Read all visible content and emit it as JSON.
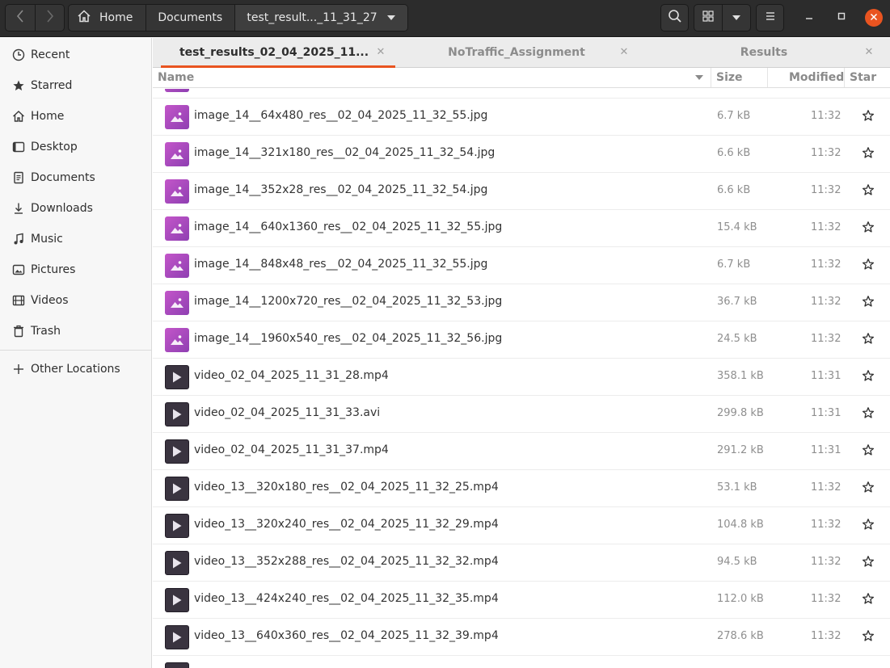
{
  "header": {
    "back_icon": "chevron-left-icon",
    "forward_icon": "chevron-right-icon",
    "breadcrumbs": [
      "Home",
      "Documents",
      "test_result..._11_31_27"
    ],
    "search_icon": "search-icon",
    "view_icon": "grid-view-icon",
    "view_menu_icon": "chevron-down-icon",
    "menu_icon": "hamburger-menu-icon"
  },
  "window": {
    "minimize_icon": "minimize-icon",
    "maximize_icon": "maximize-icon",
    "close_icon": "close-icon",
    "close_color": "#e95420"
  },
  "sidebar": {
    "items": [
      {
        "label": "Recent",
        "icon": "clock-icon"
      },
      {
        "label": "Starred",
        "icon": "star-icon"
      },
      {
        "label": "Home",
        "icon": "home-icon"
      },
      {
        "label": "Desktop",
        "icon": "desktop-icon"
      },
      {
        "label": "Documents",
        "icon": "document-icon"
      },
      {
        "label": "Downloads",
        "icon": "download-icon"
      },
      {
        "label": "Music",
        "icon": "music-icon"
      },
      {
        "label": "Pictures",
        "icon": "picture-icon"
      },
      {
        "label": "Videos",
        "icon": "video-icon"
      },
      {
        "label": "Trash",
        "icon": "trash-icon"
      }
    ],
    "other_locations": "Other Locations"
  },
  "tabs": [
    {
      "label": "test_results_02_04_2025_11...",
      "active": true
    },
    {
      "label": "NoTraffic_Assignment",
      "active": false
    },
    {
      "label": "Results",
      "active": false
    }
  ],
  "columns": {
    "name": "Name",
    "size": "Size",
    "modified": "Modified",
    "star": "Star"
  },
  "accent_color": "#e95420",
  "files": [
    {
      "name": "image_14__64x480_res__02_04_2025_11_32_55.jpg",
      "size": "6.7 kB",
      "modified": "11:32",
      "type": "image"
    },
    {
      "name": "image_14__321x180_res__02_04_2025_11_32_54.jpg",
      "size": "6.6 kB",
      "modified": "11:32",
      "type": "image"
    },
    {
      "name": "image_14__352x28_res__02_04_2025_11_32_54.jpg",
      "size": "6.6 kB",
      "modified": "11:32",
      "type": "image"
    },
    {
      "name": "image_14__640x1360_res__02_04_2025_11_32_55.jpg",
      "size": "15.4 kB",
      "modified": "11:32",
      "type": "image"
    },
    {
      "name": "image_14__848x48_res__02_04_2025_11_32_55.jpg",
      "size": "6.7 kB",
      "modified": "11:32",
      "type": "image"
    },
    {
      "name": "image_14__1200x720_res__02_04_2025_11_32_53.jpg",
      "size": "36.7 kB",
      "modified": "11:32",
      "type": "image"
    },
    {
      "name": "image_14__1960x540_res__02_04_2025_11_32_56.jpg",
      "size": "24.5 kB",
      "modified": "11:32",
      "type": "image"
    },
    {
      "name": "video_02_04_2025_11_31_28.mp4",
      "size": "358.1 kB",
      "modified": "11:31",
      "type": "video"
    },
    {
      "name": "video_02_04_2025_11_31_33.avi",
      "size": "299.8 kB",
      "modified": "11:31",
      "type": "video"
    },
    {
      "name": "video_02_04_2025_11_31_37.mp4",
      "size": "291.2 kB",
      "modified": "11:31",
      "type": "video"
    },
    {
      "name": "video_13__320x180_res__02_04_2025_11_32_25.mp4",
      "size": "53.1 kB",
      "modified": "11:32",
      "type": "video"
    },
    {
      "name": "video_13__320x240_res__02_04_2025_11_32_29.mp4",
      "size": "104.8 kB",
      "modified": "11:32",
      "type": "video"
    },
    {
      "name": "video_13__352x288_res__02_04_2025_11_32_32.mp4",
      "size": "94.5 kB",
      "modified": "11:32",
      "type": "video"
    },
    {
      "name": "video_13__424x240_res__02_04_2025_11_32_35.mp4",
      "size": "112.0 kB",
      "modified": "11:32",
      "type": "video"
    },
    {
      "name": "video_13__640x360_res__02_04_2025_11_32_39.mp4",
      "size": "278.6 kB",
      "modified": "11:32",
      "type": "video"
    }
  ]
}
